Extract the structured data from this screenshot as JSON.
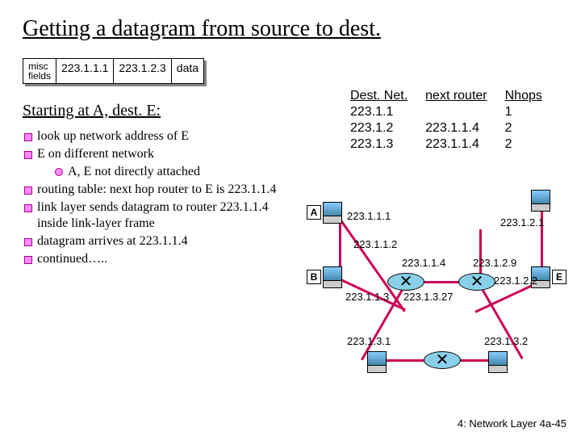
{
  "title": "Getting a datagram from source to dest.",
  "packet": {
    "misc1": "misc",
    "misc2": "fields",
    "src": "223.1.1.1",
    "dst": "223.1.2.3",
    "data": "data"
  },
  "subtitle": "Starting at A, dest. E:",
  "bullets": {
    "b1": "look up network address of E",
    "b2": "E on different network",
    "b2a": "A, E not directly attached",
    "b3": "routing table: next hop router to E is 223.1.1.4",
    "b4": "link layer sends datagram to router 223.1.1.4 inside link-layer frame",
    "b5": "datagram arrives at 223.1.1.4",
    "b6": "continued….."
  },
  "table": {
    "h1": "Dest. Net.",
    "h2": "next router",
    "h3": "Nhops",
    "r1c1": "223.1.1",
    "r1c2": "",
    "r1c3": "1",
    "r2c1": "223.1.2",
    "r2c2": "223.1.1.4",
    "r2c3": "2",
    "r3c1": "223.1.3",
    "r3c2": "223.1.1.4",
    "r3c3": "2"
  },
  "ip": {
    "a": "223.1.1.1",
    "b": "223.1.1.2",
    "c": "223.1.1.3",
    "d": "223.1.1.4",
    "e": "223.1.2.1",
    "f": "223.1.2.9",
    "g": "223.1.2.2",
    "h": "223.1.3.27",
    "i": "223.1.3.1",
    "j": "223.1.3.2"
  },
  "letters": {
    "A": "A",
    "B": "B",
    "E": "E"
  },
  "footer": "4: Network Layer   4a-45"
}
